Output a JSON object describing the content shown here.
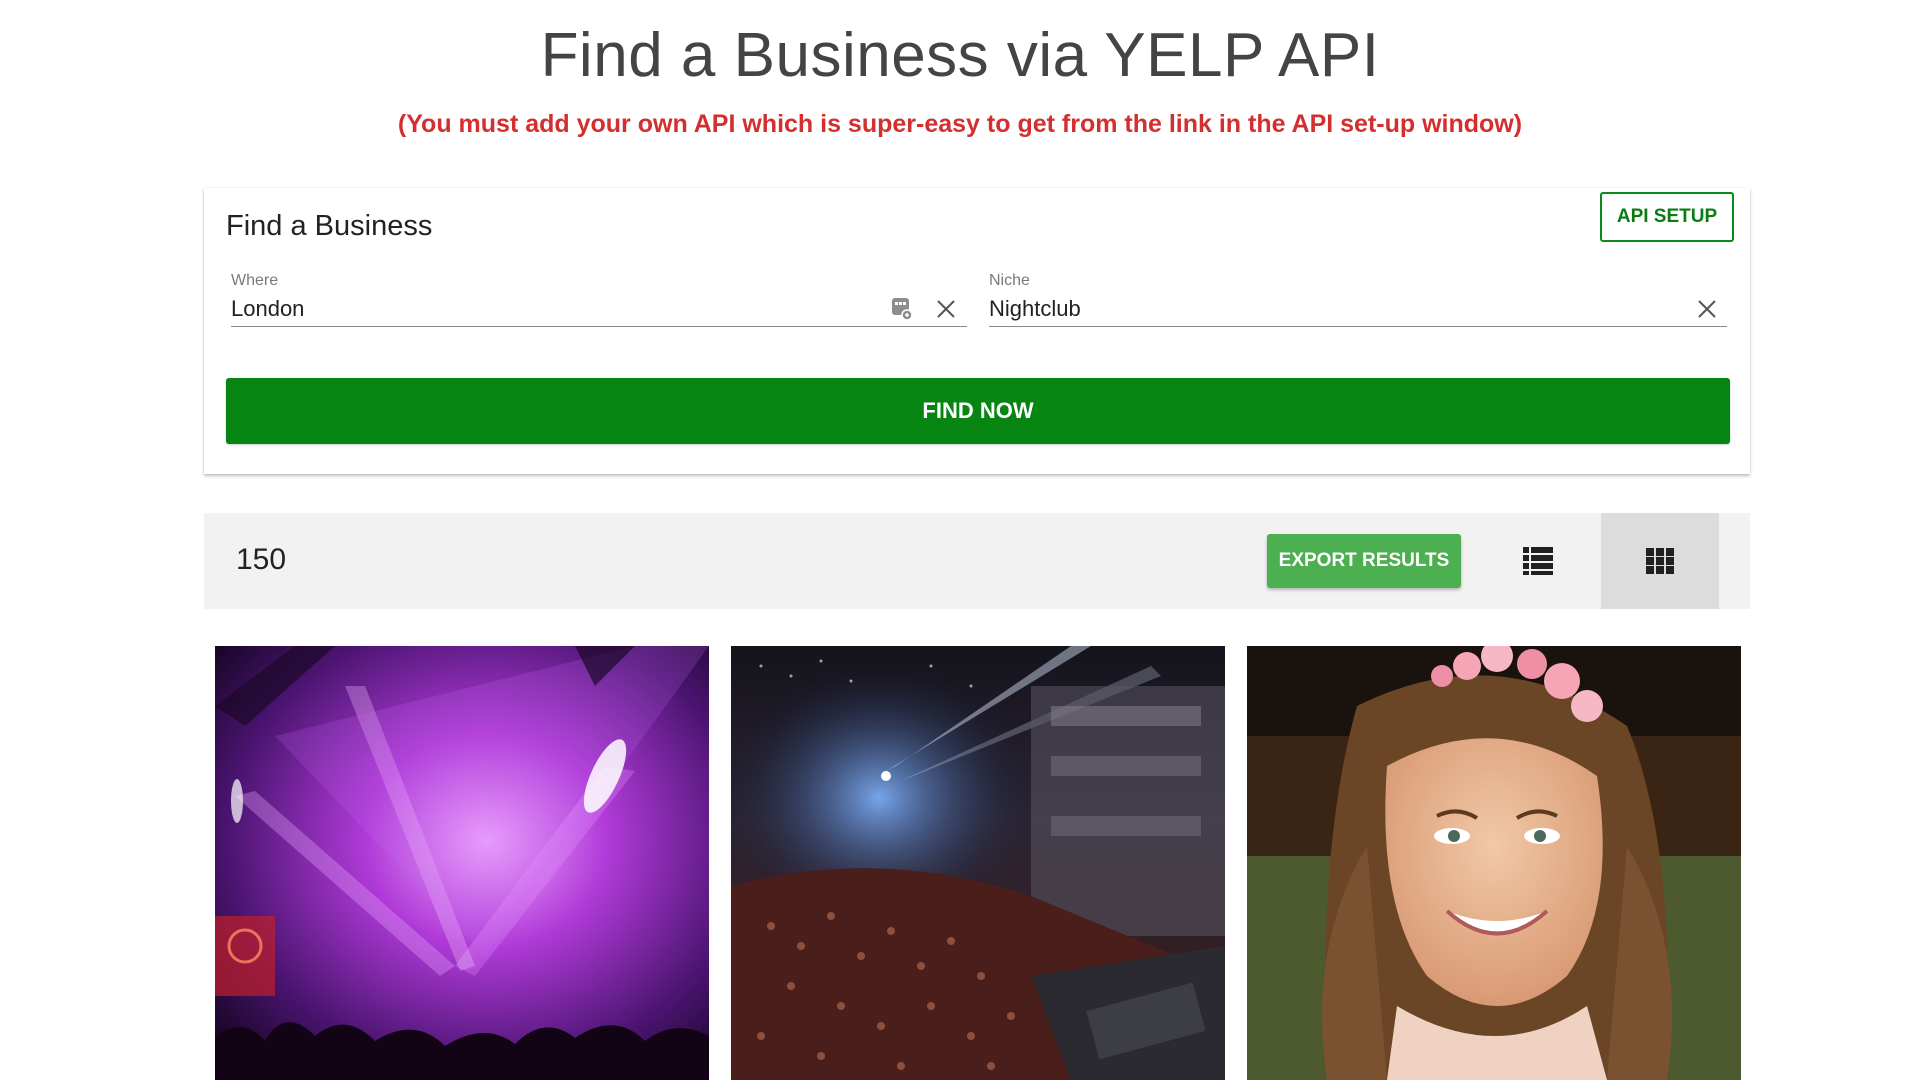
{
  "header": {
    "title": "Find a Business via YELP API",
    "subtitle": "(You must add your own API which is super-easy to get from the link in the API set-up window)"
  },
  "search_card": {
    "title": "Find a Business",
    "api_setup_label": "API SETUP",
    "where": {
      "label": "Where",
      "value": "London"
    },
    "niche": {
      "label": "Niche",
      "value": "Nightclub"
    },
    "find_now_label": "FIND NOW"
  },
  "results": {
    "count": "150",
    "export_label": "EXPORT RESULTS",
    "active_view": "grid",
    "cards": [
      {
        "image": "nightclub-lights-photo"
      },
      {
        "image": "concert-venue-crowd-photo"
      },
      {
        "image": "smiling-woman-flower-crown-photo"
      }
    ]
  },
  "colors": {
    "primary_green": "#078513",
    "export_green": "#4caf50",
    "subtitle_red": "#d32f2f",
    "title_gray": "#444444"
  },
  "icons": {
    "where_field": [
      "location-icon",
      "clear-icon"
    ],
    "niche_field": [
      "clear-icon"
    ],
    "view_toggles": [
      "list-view-icon",
      "grid-view-icon"
    ]
  }
}
